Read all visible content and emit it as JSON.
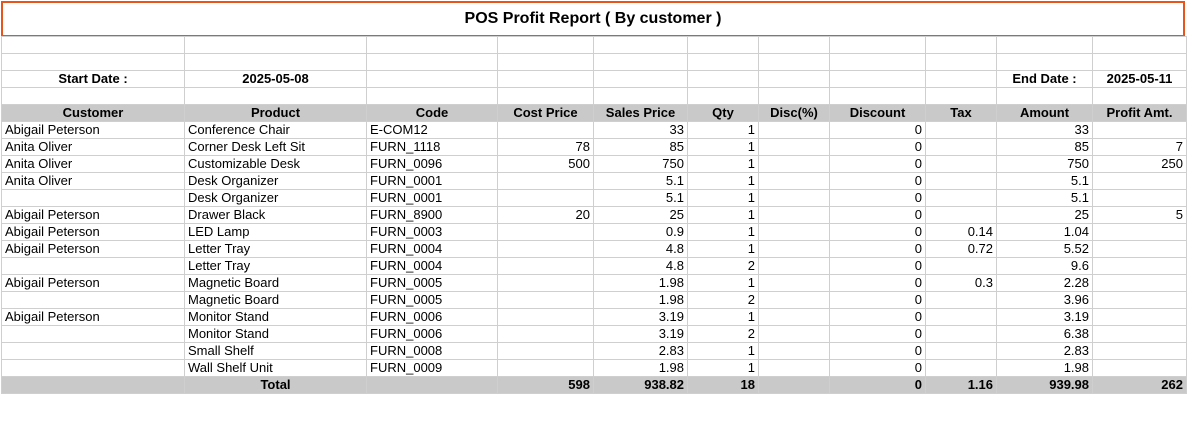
{
  "report": {
    "title": "POS Profit Report ( By customer )",
    "start_label": "Start Date :",
    "start_value": "2025-05-08",
    "end_label": "End Date :",
    "end_value": "2025-05-11"
  },
  "columns": [
    "Customer",
    "Product",
    "Code",
    "Cost Price",
    "Sales Price",
    "Qty",
    "Disc(%)",
    "Discount",
    "Tax",
    "Amount",
    "Profit Amt."
  ],
  "rows": [
    [
      "Abigail Peterson",
      "Conference Chair",
      "E-COM12",
      "",
      "33",
      "1",
      "",
      "0",
      "",
      "33",
      ""
    ],
    [
      "Anita Oliver",
      "Corner Desk Left Sit",
      "FURN_1118",
      "78",
      "85",
      "1",
      "",
      "0",
      "",
      "85",
      "7"
    ],
    [
      "Anita Oliver",
      "Customizable Desk",
      "FURN_0096",
      "500",
      "750",
      "1",
      "",
      "0",
      "",
      "750",
      "250"
    ],
    [
      "Anita Oliver",
      "Desk Organizer",
      "FURN_0001",
      "",
      "5.1",
      "1",
      "",
      "0",
      "",
      "5.1",
      ""
    ],
    [
      "",
      "Desk Organizer",
      "FURN_0001",
      "",
      "5.1",
      "1",
      "",
      "0",
      "",
      "5.1",
      ""
    ],
    [
      "Abigail Peterson",
      "Drawer Black",
      "FURN_8900",
      "20",
      "25",
      "1",
      "",
      "0",
      "",
      "25",
      "5"
    ],
    [
      "Abigail Peterson",
      "LED Lamp",
      "FURN_0003",
      "",
      "0.9",
      "1",
      "",
      "0",
      "0.14",
      "1.04",
      ""
    ],
    [
      "Abigail Peterson",
      "Letter Tray",
      "FURN_0004",
      "",
      "4.8",
      "1",
      "",
      "0",
      "0.72",
      "5.52",
      ""
    ],
    [
      "",
      "Letter Tray",
      "FURN_0004",
      "",
      "4.8",
      "2",
      "",
      "0",
      "",
      "9.6",
      ""
    ],
    [
      "Abigail Peterson",
      "Magnetic Board",
      "FURN_0005",
      "",
      "1.98",
      "1",
      "",
      "0",
      "0.3",
      "2.28",
      ""
    ],
    [
      "",
      "Magnetic Board",
      "FURN_0005",
      "",
      "1.98",
      "2",
      "",
      "0",
      "",
      "3.96",
      ""
    ],
    [
      "Abigail Peterson",
      "Monitor Stand",
      "FURN_0006",
      "",
      "3.19",
      "1",
      "",
      "0",
      "",
      "3.19",
      ""
    ],
    [
      "",
      "Monitor Stand",
      "FURN_0006",
      "",
      "3.19",
      "2",
      "",
      "0",
      "",
      "6.38",
      ""
    ],
    [
      "",
      "Small Shelf",
      "FURN_0008",
      "",
      "2.83",
      "1",
      "",
      "0",
      "",
      "2.83",
      ""
    ],
    [
      "",
      "Wall Shelf Unit",
      "FURN_0009",
      "",
      "1.98",
      "1",
      "",
      "0",
      "",
      "1.98",
      ""
    ]
  ],
  "total": [
    "",
    "Total",
    "",
    "598",
    "938.82",
    "18",
    "",
    "0",
    "1.16",
    "939.98",
    "262"
  ]
}
